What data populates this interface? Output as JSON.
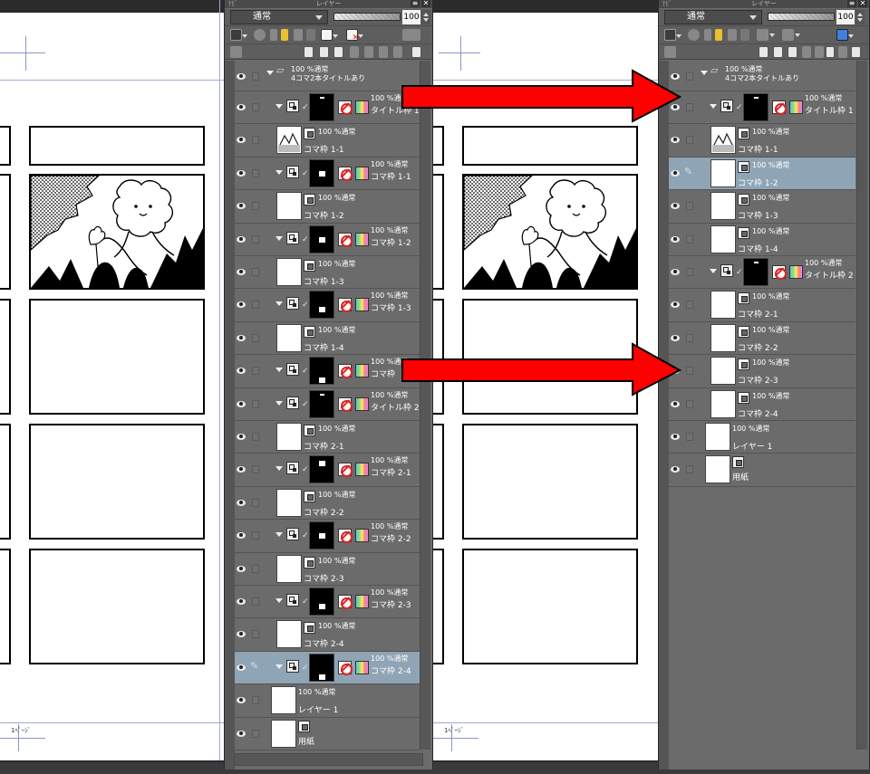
{
  "left_panel": {
    "title": "レイヤー",
    "tab_left": "ﾅﾋﾞ",
    "blend_mode": "通常",
    "opacity": "100",
    "layers": [
      {
        "kind": "folder",
        "percent": "100 %通常",
        "name": "4コマ2本タイトルあり"
      },
      {
        "kind": "frame",
        "percent": "100 %通常",
        "name": "タイトル枠 1",
        "mark": "bar-top"
      },
      {
        "kind": "raster",
        "percent": "100 %通常",
        "name": "コマ枠 1-1",
        "sketch": true
      },
      {
        "kind": "frame",
        "percent": "100 %通常",
        "name": "コマ枠 1-1",
        "mark": "box-mid"
      },
      {
        "kind": "raster",
        "percent": "100 %通常",
        "name": "コマ枠 1-2"
      },
      {
        "kind": "frame",
        "percent": "100 %通常",
        "name": "コマ枠 1-2",
        "mark": "box-mid"
      },
      {
        "kind": "raster",
        "percent": "100 %通常",
        "name": "コマ枠 1-3"
      },
      {
        "kind": "frame",
        "percent": "100 %通常",
        "name": "コマ枠 1-3",
        "mark": "box-low"
      },
      {
        "kind": "raster",
        "percent": "100 %通常",
        "name": "コマ枠 1-4"
      },
      {
        "kind": "frame",
        "percent": "100 %通常",
        "name": "コマ枠",
        "mark": "box-bottom"
      },
      {
        "kind": "frame",
        "percent": "100 %通常",
        "name": "タイトル枠 2",
        "mark": "bar-top"
      },
      {
        "kind": "raster",
        "percent": "100 %通常",
        "name": "コマ枠 2-1"
      },
      {
        "kind": "frame",
        "percent": "100 %通常",
        "name": "コマ枠 2-1",
        "mark": "box-top"
      },
      {
        "kind": "raster",
        "percent": "100 %通常",
        "name": "コマ枠 2-2"
      },
      {
        "kind": "frame",
        "percent": "100 %通常",
        "name": "コマ枠 2-2",
        "mark": "box-mid"
      },
      {
        "kind": "raster",
        "percent": "100 %通常",
        "name": "コマ枠 2-3"
      },
      {
        "kind": "frame",
        "percent": "100 %通常",
        "name": "コマ枠 2-3",
        "mark": "box-low"
      },
      {
        "kind": "raster",
        "percent": "100 %通常",
        "name": "コマ枠 2-4"
      },
      {
        "kind": "frame",
        "percent": "100 %通常",
        "name": "コマ枠 2-4",
        "mark": "box-bottom",
        "selected": true
      },
      {
        "kind": "plain",
        "percent": "100 %通常",
        "name": "レイヤー 1"
      },
      {
        "kind": "paper",
        "percent": "",
        "name": "用紙"
      }
    ]
  },
  "right_panel": {
    "title": "レイヤー",
    "tab_left": "ﾅﾋﾞ",
    "blend_mode": "通常",
    "opacity": "100",
    "layers": [
      {
        "kind": "folder",
        "percent": "100 %通常",
        "name": "4コマ2本タイトルあり"
      },
      {
        "kind": "frame",
        "percent": "100 %通常",
        "name": "タイトル枠 1",
        "mark": "bar-top"
      },
      {
        "kind": "raster",
        "percent": "100 %通常",
        "name": "コマ枠 1-1",
        "sketch": true
      },
      {
        "kind": "raster",
        "percent": "100 %通常",
        "name": "コマ枠 1-2",
        "selected": true
      },
      {
        "kind": "raster",
        "percent": "100 %通常",
        "name": "コマ枠 1-3"
      },
      {
        "kind": "raster",
        "percent": "100 %通常",
        "name": "コマ枠 1-4"
      },
      {
        "kind": "frame",
        "percent": "100 %通常",
        "name": "タイトル枠 2",
        "mark": "bar-top"
      },
      {
        "kind": "raster",
        "percent": "100 %通常",
        "name": "コマ枠 2-1"
      },
      {
        "kind": "raster",
        "percent": "100 %通常",
        "name": "コマ枠 2-2"
      },
      {
        "kind": "raster",
        "percent": "100 %通常",
        "name": "コマ枠 2-3"
      },
      {
        "kind": "raster",
        "percent": "100 %通常",
        "name": "コマ枠 2-4"
      },
      {
        "kind": "plain",
        "percent": "100 %通常",
        "name": "レイヤー 1"
      },
      {
        "kind": "paper",
        "percent": "",
        "name": "用紙"
      }
    ]
  },
  "canvas": {
    "page_label": "1ﾍﾟｰｼﾞ"
  },
  "colors": {
    "arrow_red": "#ff0000",
    "selected_row": "#8fa4b5",
    "panel_bg": "#6b6b6b"
  }
}
